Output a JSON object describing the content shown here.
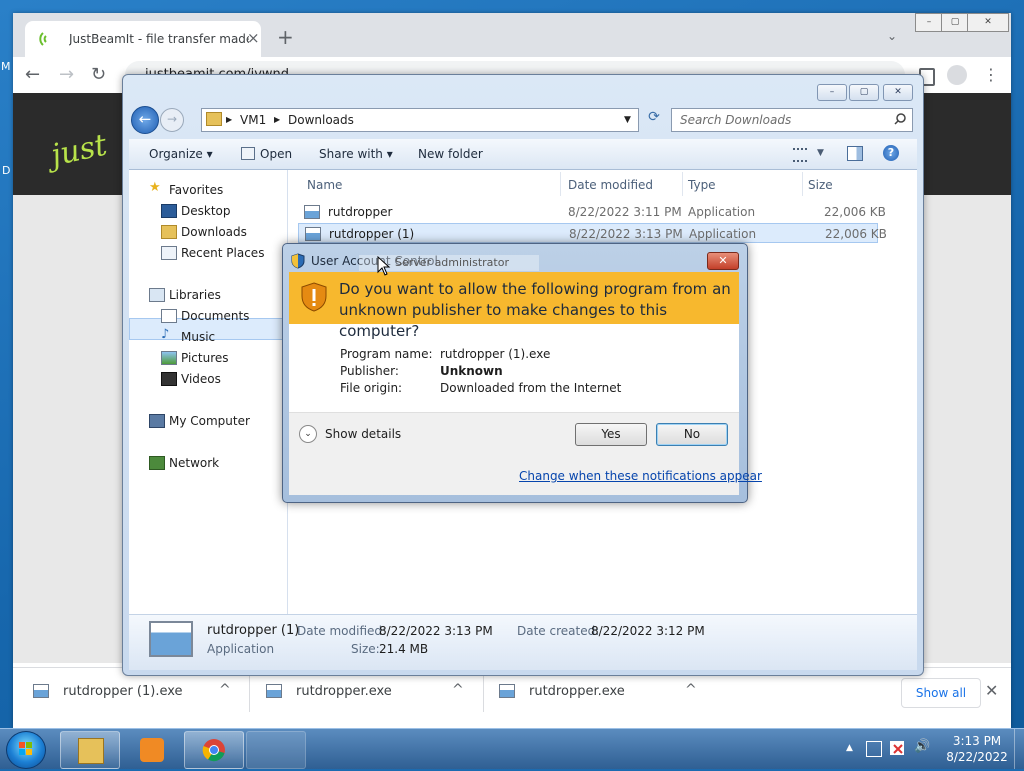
{
  "desktop": {
    "fragments": [
      "M",
      "D"
    ]
  },
  "browser": {
    "tab_title": "JustBeamIt - file transfer made e",
    "tab_close": "×",
    "new_tab": "+",
    "tab_search": "⌄",
    "window_controls": {
      "minimize": "–",
      "maximize": "▢",
      "close": "✕"
    },
    "back": "←",
    "forward": "→",
    "reload": "↻",
    "url": "justbeamit.com/jvwnd",
    "page_brand": "just",
    "menu": "⋮",
    "accent": "#1a73e8"
  },
  "downloads_bar": {
    "items": [
      {
        "name": "rutdropper (1).exe",
        "caret": "^"
      },
      {
        "name": "rutdropper.exe",
        "caret": "^"
      },
      {
        "name": "rutdropper.exe",
        "caret": "^"
      }
    ],
    "show_all": "Show all",
    "close": "✕"
  },
  "explorer": {
    "window_controls": {
      "minimize": "–",
      "maximize": "▢",
      "close": "✕"
    },
    "back": "←",
    "forward": "→",
    "breadcrumb": [
      "VM1",
      "Downloads"
    ],
    "breadcrumb_sep": "▶",
    "refresh": "⟳",
    "search_placeholder": "Search Downloads",
    "toolbar": {
      "organize": "Organize ▾",
      "open": "Open",
      "share_with": "Share with ▾",
      "new_folder": "New folder"
    },
    "nav": {
      "favorites": "Favorites",
      "desktop": "Desktop",
      "downloads": "Downloads",
      "recent_places": "Recent Places",
      "libraries": "Libraries",
      "documents": "Documents",
      "music": "Music",
      "pictures": "Pictures",
      "videos": "Videos",
      "my_computer": "My Computer",
      "network": "Network"
    },
    "columns": [
      "Name",
      "Date modified",
      "Type",
      "Size"
    ],
    "files": [
      {
        "name": "rutdropper",
        "date": "8/22/2022 3:11 PM",
        "type": "Application",
        "size": "22,006 KB"
      },
      {
        "name": "rutdropper (1)",
        "date": "8/22/2022 3:13 PM",
        "type": "Application",
        "size": "22,006 KB"
      }
    ],
    "details": {
      "name": "rutdropper (1)",
      "type": "Application",
      "date_modified_label": "Date modified:",
      "date_modified": "8/22/2022 3:13 PM",
      "date_created_label": "Date created:",
      "date_created": "8/22/2022 3:12 PM",
      "size_label": "Size:",
      "size": "21.4 MB"
    }
  },
  "uac": {
    "title": "User Account Control",
    "subtitle": "Server administrator",
    "close": "✕",
    "question": "Do you want to allow the following program from an unknown publisher to make changes to this computer?",
    "program_name_label": "Program name:",
    "program_name": "rutdropper (1).exe",
    "publisher_label": "Publisher:",
    "publisher": "Unknown",
    "file_origin_label": "File origin:",
    "file_origin": "Downloaded from the Internet",
    "show_details": "Show details",
    "chevron": "⌄",
    "yes": "Yes",
    "no": "No",
    "change_link": "Change when these notifications appear",
    "warn_color": "#f7b82e"
  },
  "taskbar": {
    "time": "3:13 PM",
    "date": "8/22/2022",
    "tray_arrow": "▲",
    "speaker": "🔊"
  }
}
